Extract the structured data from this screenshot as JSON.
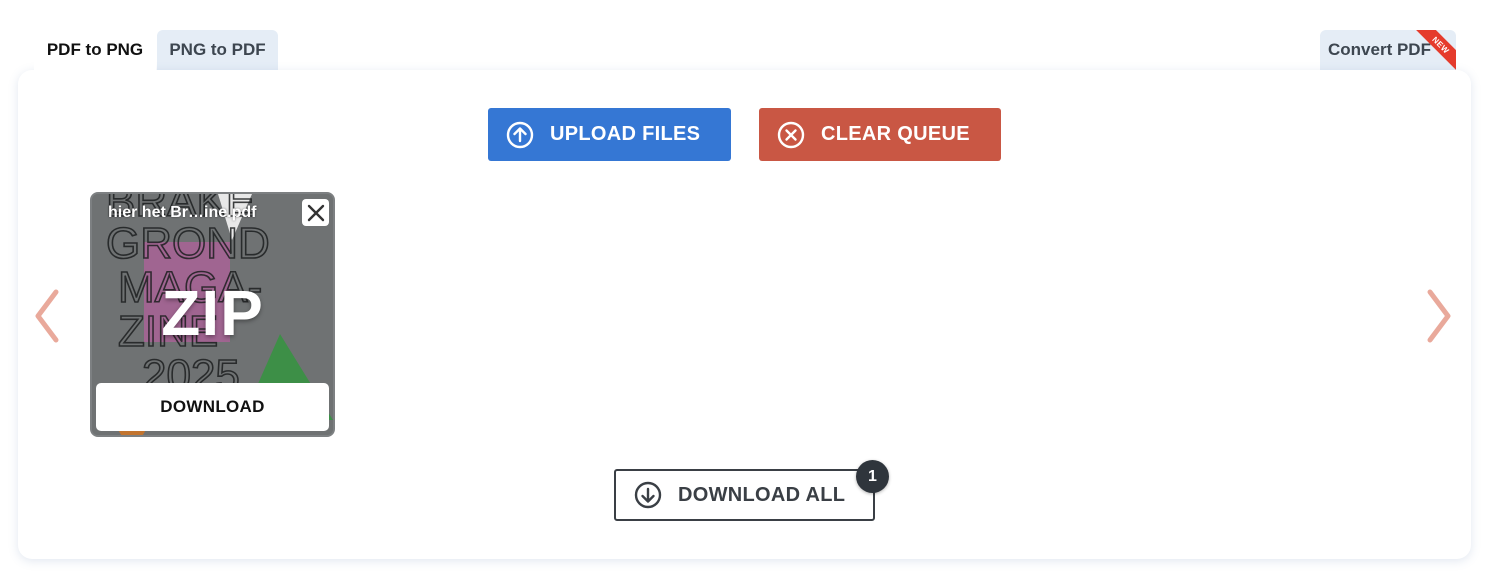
{
  "tabs": {
    "active": "PDF to PNG",
    "inactive": "PNG to PDF",
    "right": "Convert PDF",
    "right_ribbon": "NEW"
  },
  "actions": {
    "upload_label": "UPLOAD FILES",
    "clear_label": "CLEAR QUEUE"
  },
  "queue": {
    "items": [
      {
        "filename": "hier het Br…ine.pdf",
        "type_label": "ZIP",
        "download_label": "DOWNLOAD",
        "preview_text": [
          "BRAKE",
          "GROND",
          "MAGA-",
          "ZINE",
          "2025"
        ]
      }
    ]
  },
  "download_all": {
    "label": "DOWNLOAD ALL",
    "count": "1"
  },
  "colors": {
    "upload": "#3577d4",
    "clear": "#c95744",
    "arrows": "#e9a99b",
    "ribbon": "#e53b2c"
  }
}
